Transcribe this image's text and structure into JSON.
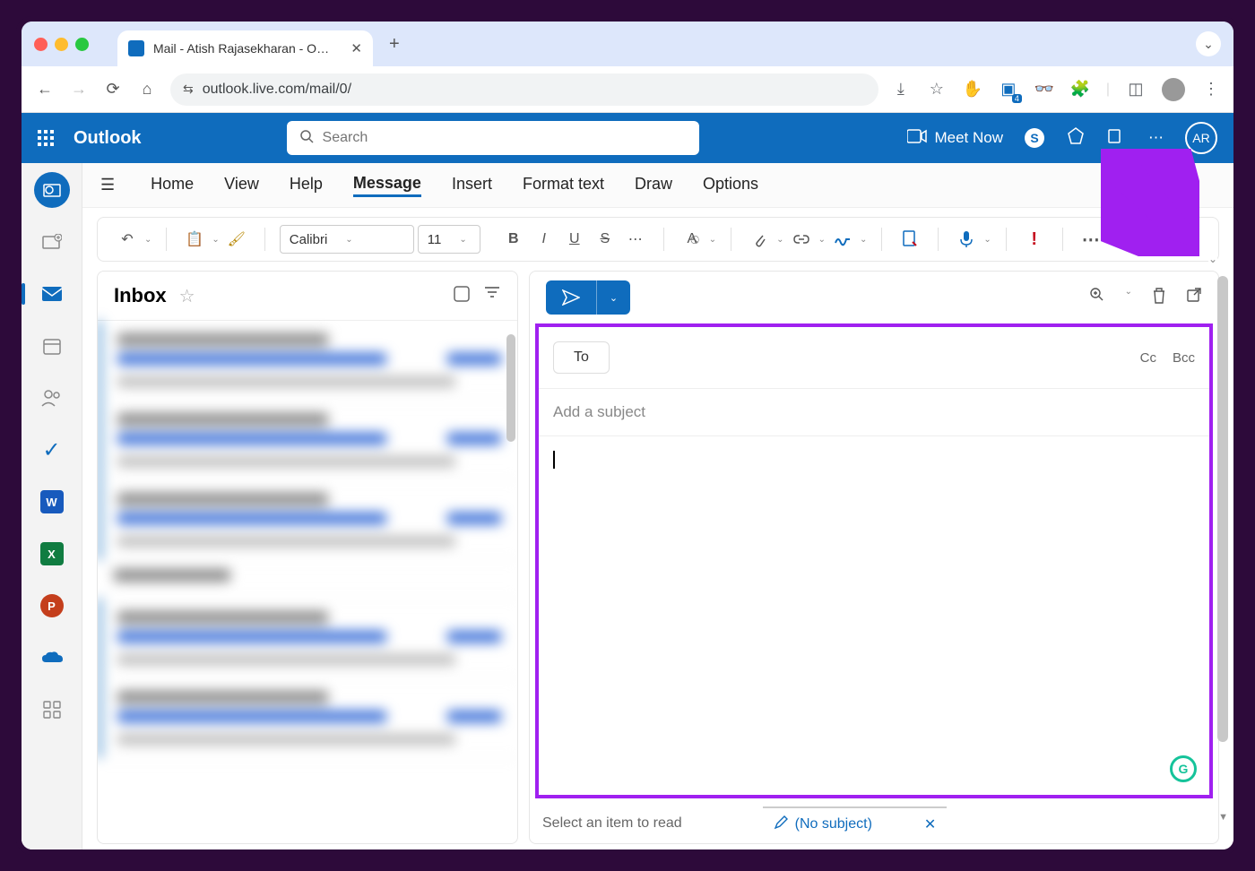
{
  "browser": {
    "tab_title": "Mail - Atish Rajasekharan - O…",
    "url": "outlook.live.com/mail/0/"
  },
  "header": {
    "app_name": "Outlook",
    "search_placeholder": "Search",
    "meet_now": "Meet Now",
    "avatar_initials": "AR"
  },
  "tabs": {
    "home": "Home",
    "view": "View",
    "help": "Help",
    "message": "Message",
    "insert": "Insert",
    "format_text": "Format text",
    "draw": "Draw",
    "options": "Options"
  },
  "format": {
    "font_name": "Calibri",
    "font_size": "11"
  },
  "mailbox": {
    "title": "Inbox"
  },
  "compose": {
    "to_label": "To",
    "cc_label": "Cc",
    "bcc_label": "Bcc",
    "subject_placeholder": "Add a subject"
  },
  "footer": {
    "select_item": "Select an item to read",
    "no_subject": "(No subject)"
  },
  "rail_apps": {
    "word": "W",
    "excel": "X",
    "ppt": "P"
  }
}
